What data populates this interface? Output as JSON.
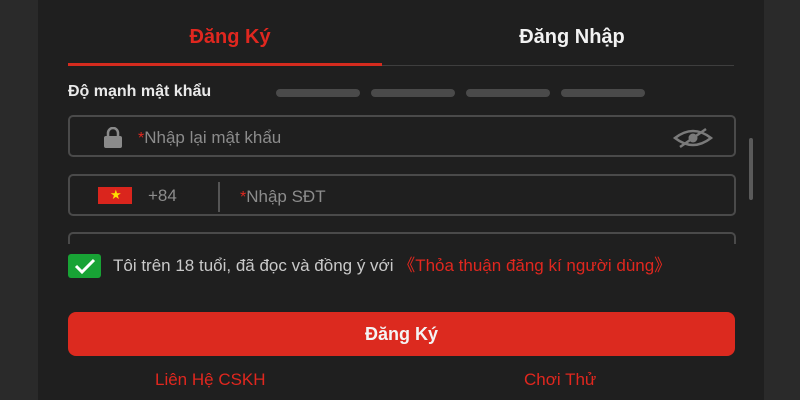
{
  "tabs": {
    "register": "Đăng Ký",
    "login": "Đăng Nhập"
  },
  "strength": {
    "label": "Độ mạnh mật khẩu",
    "level": 0,
    "segments": 4
  },
  "password_confirm": {
    "required_mark": "*",
    "placeholder": "Nhập lại mật khẩu",
    "icon": "lock-icon",
    "toggle_icon": "eye-off-icon"
  },
  "phone": {
    "flag_icon": "vietnam-flag-icon",
    "country_code": "+84",
    "required_mark": "*",
    "placeholder": "Nhập SĐT"
  },
  "agreement": {
    "checked": true,
    "text": "Tôi trên 18 tuổi, đã đọc và đồng ý với ",
    "link": "《Thỏa thuận đăng kí người dùng》"
  },
  "submit_label": "Đăng Ký",
  "footer": {
    "contact": "Liên Hệ CSKH",
    "trial": "Chơi Thử"
  },
  "colors": {
    "accent": "#dc2a1f",
    "checkbox": "#18a335",
    "background": "#1f1f1f"
  }
}
